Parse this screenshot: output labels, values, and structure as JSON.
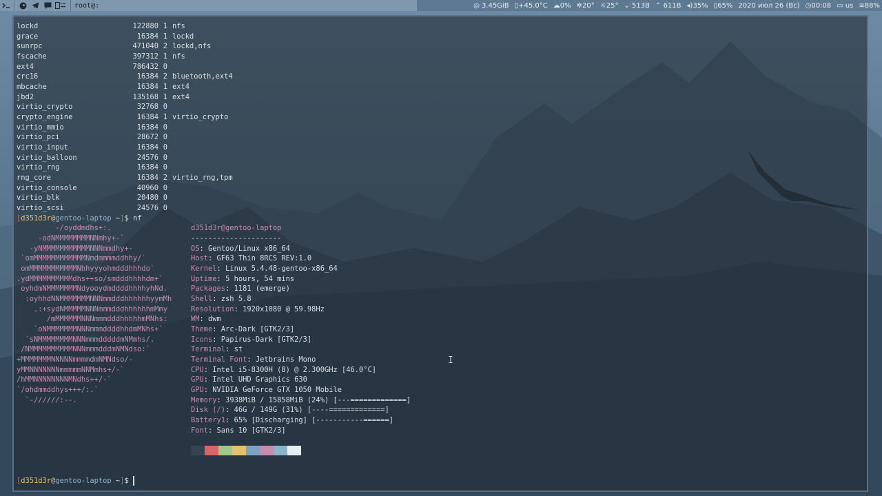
{
  "topbar": {
    "window_title": "root@:",
    "status": {
      "memory": "3.45GiB",
      "temp": "+45.0°C",
      "weather_precip": "0%",
      "temp_outside": "20°",
      "sun": "25°",
      "net_down": "513B",
      "net_up": "611B",
      "volume": "35%",
      "brightness": "65%",
      "date": "2020 июл 26 (Вс)",
      "time": "00:08",
      "layout": "us",
      "wifi": "88%"
    }
  },
  "modules": [
    {
      "name": "lockd",
      "size": "122880",
      "used": "1",
      "by": "nfs"
    },
    {
      "name": "grace",
      "size": "16384",
      "used": "1",
      "by": "lockd"
    },
    {
      "name": "sunrpc",
      "size": "471040",
      "used": "2",
      "by": "lockd,nfs"
    },
    {
      "name": "fscache",
      "size": "397312",
      "used": "1",
      "by": "nfs"
    },
    {
      "name": "ext4",
      "size": "786432",
      "used": "0",
      "by": ""
    },
    {
      "name": "crc16",
      "size": "16384",
      "used": "2",
      "by": "bluetooth,ext4"
    },
    {
      "name": "mbcache",
      "size": "16384",
      "used": "1",
      "by": "ext4"
    },
    {
      "name": "jbd2",
      "size": "135168",
      "used": "1",
      "by": "ext4"
    },
    {
      "name": "virtio_crypto",
      "size": "32768",
      "used": "0",
      "by": ""
    },
    {
      "name": "crypto_engine",
      "size": "16384",
      "used": "1",
      "by": "virtio_crypto"
    },
    {
      "name": "virtio_mmio",
      "size": "16384",
      "used": "0",
      "by": ""
    },
    {
      "name": "virtio_pci",
      "size": "28672",
      "used": "0",
      "by": ""
    },
    {
      "name": "virtio_input",
      "size": "16384",
      "used": "0",
      "by": ""
    },
    {
      "name": "virtio_balloon",
      "size": "24576",
      "used": "0",
      "by": ""
    },
    {
      "name": "virtio_rng",
      "size": "16384",
      "used": "0",
      "by": ""
    },
    {
      "name": "rng_core",
      "size": "16384",
      "used": "2",
      "by": "virtio_rng,tpm"
    },
    {
      "name": "virtio_console",
      "size": "40960",
      "used": "0",
      "by": ""
    },
    {
      "name": "virtio_blk",
      "size": "20480",
      "used": "0",
      "by": ""
    },
    {
      "name": "virtio_scsi",
      "size": "24576",
      "used": "0",
      "by": ""
    }
  ],
  "prompt": {
    "user": "d351d3r",
    "at": "@",
    "host": "gentoo-laptop",
    "path": " ~",
    "symbol": "$",
    "command": "nf"
  },
  "logo_lines": [
    "         -/oyddmdhs+:.",
    "     -odNMMMMMMMMNNmhy+-`",
    "   -yNMMMMMMMMMMMNNNmmdhy+-",
    " `omMMMMMMMMMMMMNmdmmmmddhhy/`",
    " omMMMMMMMMMMMNhhyyyohmdddhhhdo`",
    ".ydMMMMMMMMMMdhs++so/smdddhhhhdm+`",
    " oyhdmNMMMMMMMNdyooydmddddhhhhyhNd.",
    "  :oyhhdNNMMMMMMMNNNmmdddhhhhhhyymMh",
    "    .:+sydNMMMMMNNNmmmdddhhhhhhmMmy",
    "       /mMMMMMMNNNmmmdddhhhhhmMNhs:",
    "    `oNMMMMMMMNNNmmmddddhhdmMNhs+`",
    "  `sNMMMMMMMMNNNmmmdddddmNMmhs/.",
    " /NMMMMMMMMMMNNNmmmdddmNMNdso:`",
    "+MMMMMMMNNNNNmmmmdmNMNdso/-",
    "yMMNNNNNNNmmmmmNNMmhs+/-`",
    "/hMMNNNNNNNNMNdhs++/-`",
    "`/ohdmmddhys+++/:.`",
    "  `-//////:--."
  ],
  "info": {
    "header": "d351d3r@gentoo-laptop",
    "separator": "---------------------",
    "rows": [
      {
        "key": "OS",
        "value": "Gentoo/Linux x86_64"
      },
      {
        "key": "Host",
        "value": "GF63 Thin 8RCS REV:1.0"
      },
      {
        "key": "Kernel",
        "value": "Linux 5.4.48-gentoo-x86_64"
      },
      {
        "key": "Uptime",
        "value": "5 hours, 54 mins"
      },
      {
        "key": "Packages",
        "value": "1181 (emerge)"
      },
      {
        "key": "Shell",
        "value": "zsh 5.8"
      },
      {
        "key": "Resolution",
        "value": "1920x1080 @ 59.98Hz"
      },
      {
        "key": "WM",
        "value": "dwm"
      },
      {
        "key": "Theme",
        "value": "Arc-Dark [GTK2/3]"
      },
      {
        "key": "Icons",
        "value": "Papirus-Dark [GTK2/3]"
      },
      {
        "key": "Terminal",
        "value": "st"
      },
      {
        "key": "Terminal Font",
        "value": "Jetbrains Mono"
      },
      {
        "key": "CPU",
        "value": "Intel i5-8300H (8) @ 2.300GHz [46.0°C]"
      },
      {
        "key": "GPU",
        "value": "Intel UHD Graphics 630"
      },
      {
        "key": "GPU",
        "value": "NVIDIA GeForce GTX 1050 Mobile"
      },
      {
        "key": "Memory",
        "value": "3938MiB / 15858MiB (24%) [---=============]"
      },
      {
        "key": "Disk (/)",
        "value": "46G / 149G (31%) [----=============]"
      },
      {
        "key": "Battery1",
        "value": "65% [Discharging] [-----------======]"
      },
      {
        "key": "Font",
        "value": "Sans 10 [GTK2/3]"
      }
    ],
    "palette": [
      "#3a4450",
      "#d3686c",
      "#a3c58a",
      "#e6c071",
      "#7fa1c4",
      "#c48db0",
      "#8ab5c9",
      "#e6edf3"
    ]
  }
}
